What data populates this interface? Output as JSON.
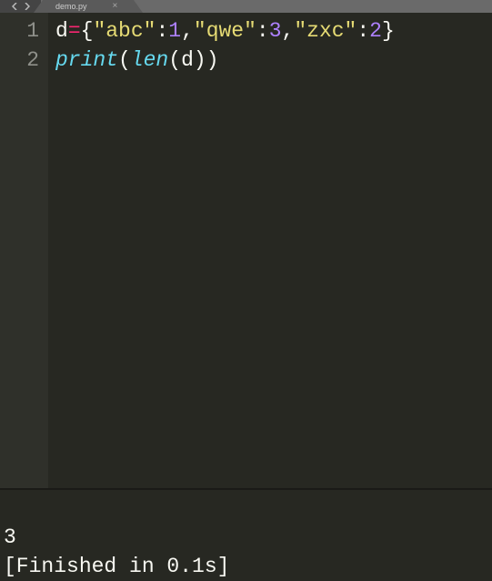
{
  "tab": {
    "filename": "demo.py",
    "close_glyph": "×"
  },
  "editor": {
    "line_numbers": [
      "1",
      "2"
    ],
    "lines": [
      [
        {
          "t": "d",
          "c": "tok-var"
        },
        {
          "t": "=",
          "c": "tok-op"
        },
        {
          "t": "{",
          "c": "tok-pun"
        },
        {
          "t": "\"abc\"",
          "c": "tok-str"
        },
        {
          "t": ":",
          "c": "tok-pun"
        },
        {
          "t": "1",
          "c": "tok-num"
        },
        {
          "t": ",",
          "c": "tok-pun"
        },
        {
          "t": "\"qwe\"",
          "c": "tok-str"
        },
        {
          "t": ":",
          "c": "tok-pun"
        },
        {
          "t": "3",
          "c": "tok-num"
        },
        {
          "t": ",",
          "c": "tok-pun"
        },
        {
          "t": "\"zxc\"",
          "c": "tok-str"
        },
        {
          "t": ":",
          "c": "tok-pun"
        },
        {
          "t": "2",
          "c": "tok-num"
        },
        {
          "t": "}",
          "c": "tok-pun"
        }
      ],
      [
        {
          "t": "print",
          "c": "tok-fn"
        },
        {
          "t": "(",
          "c": "tok-pun"
        },
        {
          "t": "len",
          "c": "tok-fn"
        },
        {
          "t": "(",
          "c": "tok-pun"
        },
        {
          "t": "d",
          "c": "tok-var"
        },
        {
          "t": ")",
          "c": "tok-pun"
        },
        {
          "t": ")",
          "c": "tok-pun"
        }
      ]
    ]
  },
  "console": {
    "output": "3",
    "status": "[Finished in 0.1s]"
  }
}
